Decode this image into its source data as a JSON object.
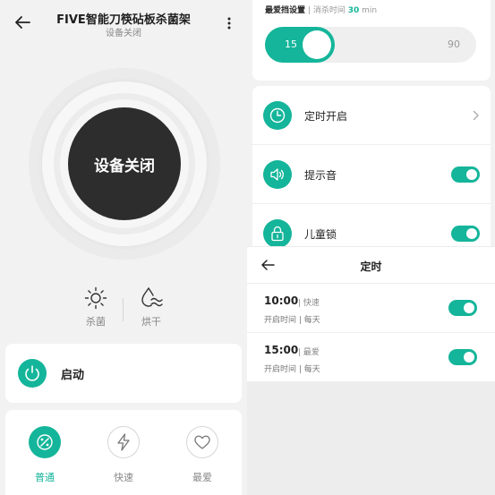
{
  "device": {
    "name": "FIVE智能刀筷砧板杀菌架",
    "status": "设备关闭",
    "power_button_label": "设备关闭"
  },
  "features": [
    {
      "label": "杀菌",
      "icon": "sun-icon"
    },
    {
      "label": "烘干",
      "icon": "drying-icon"
    }
  ],
  "start": {
    "label": "启动",
    "icon": "power-icon"
  },
  "modes": [
    {
      "label": "普通",
      "icon": "normal-mode-icon",
      "active": true
    },
    {
      "label": "快速",
      "icon": "lightning-icon",
      "active": false
    },
    {
      "label": "最爱",
      "icon": "heart-icon",
      "active": false
    }
  ],
  "favorite": {
    "title": "最爱挡设置",
    "separator": "|",
    "duration_label": "消杀时间",
    "duration_value": "30",
    "duration_unit": "min",
    "slider_min": "15",
    "slider_max": "90",
    "slider_level_fraction": 0.33
  },
  "settings": [
    {
      "label": "定时开启",
      "icon": "clock-icon",
      "control": "chevron"
    },
    {
      "label": "提示音",
      "icon": "speaker-icon",
      "control": "toggle",
      "on": true
    },
    {
      "label": "儿童锁",
      "icon": "lock-icon",
      "control": "toggle",
      "on": true
    }
  ],
  "timer": {
    "title": "定时",
    "items": [
      {
        "time": "10:00",
        "tag": "快速",
        "desc": "开启时间 | 每天",
        "on": true
      },
      {
        "time": "15:00",
        "tag": "最爱",
        "desc": "开启时间 | 每天",
        "on": true
      }
    ]
  },
  "colors": {
    "accent": "#14b59a",
    "dark_button": "#2d2d2d",
    "background": "#f2f2f2"
  }
}
